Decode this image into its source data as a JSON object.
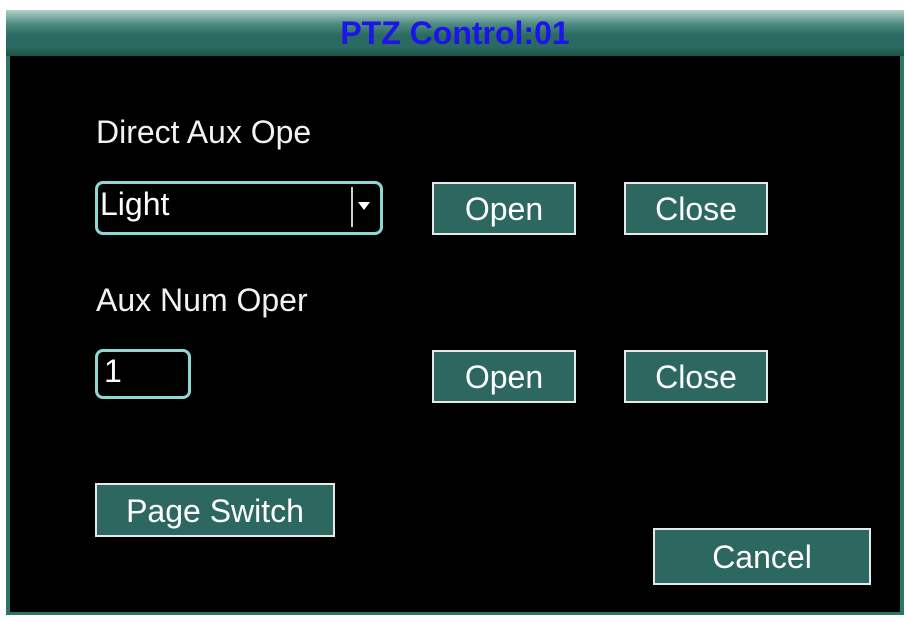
{
  "window": {
    "title": "PTZ Control:01"
  },
  "direct_aux": {
    "label": "Direct Aux Ope",
    "select_value": "Light",
    "select_icon": "chevron-down-icon",
    "open_label": "Open",
    "close_label": "Close"
  },
  "aux_num": {
    "label": "Aux Num Oper",
    "value": "1",
    "open_label": "Open",
    "close_label": "Close"
  },
  "footer": {
    "page_switch_label": "Page Switch",
    "cancel_label": "Cancel"
  },
  "colors": {
    "title_text": "#1c14e8",
    "button_fill": "#2c6860",
    "field_border": "#8fd7d3",
    "frame": "#2d7568"
  }
}
